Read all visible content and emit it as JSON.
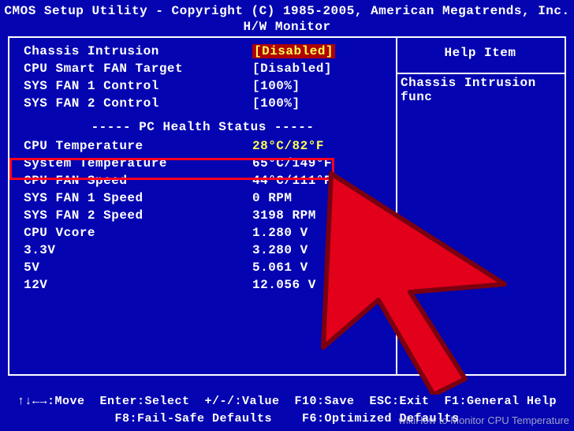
{
  "header": {
    "line1": "CMOS Setup Utility - Copyright (C) 1985-2005, American Megatrends, Inc.",
    "line2": "H/W Monitor"
  },
  "settings": [
    {
      "label": "Chassis Intrusion",
      "value": "[Disabled]",
      "selected": true
    },
    {
      "label": "CPU Smart FAN Target",
      "value": "[Disabled]"
    },
    {
      "label": "SYS FAN 1 Control",
      "value": "[100%]"
    },
    {
      "label": "SYS FAN 2 Control",
      "value": "[100%]"
    }
  ],
  "health_title": "----- PC Health Status -----",
  "health": [
    {
      "label": "CPU Temperature",
      "value": "28°C/82°F",
      "highlight": true
    },
    {
      "label": "System Temperature",
      "value": "65°C/149°F"
    },
    {
      "label": "CPU FAN Speed",
      "value": "44°C/111°F"
    },
    {
      "label": "SYS FAN 1 Speed",
      "value": "0 RPM"
    },
    {
      "label": "SYS FAN 2 Speed",
      "value": "3198 RPM"
    },
    {
      "label": "CPU Vcore",
      "value": "1.280 V"
    },
    {
      "label": "3.3V",
      "value": "3.280 V"
    },
    {
      "label": "5V",
      "value": "5.061 V"
    },
    {
      "label": "12V",
      "value": "12.056 V"
    }
  ],
  "help": {
    "title": "Help Item",
    "body": "Chassis Intrusion func"
  },
  "footer": {
    "line1": "↑↓←→:Move  Enter:Select  +/-/:Value  F10:Save  ESC:Exit  F1:General Help",
    "line2": "F8:Fail-Safe Defaults    F6:Optimized Defaults"
  },
  "watermark": "wikiHow to Monitor CPU Temperature",
  "colors": {
    "bg": "#0404b0",
    "fg": "#ffffff",
    "accent": "#ffff55",
    "highlight_bg": "#b00000",
    "red_box": "#ff0020",
    "cursor_fill": "#e3001a",
    "cursor_stroke": "#7a0010"
  }
}
